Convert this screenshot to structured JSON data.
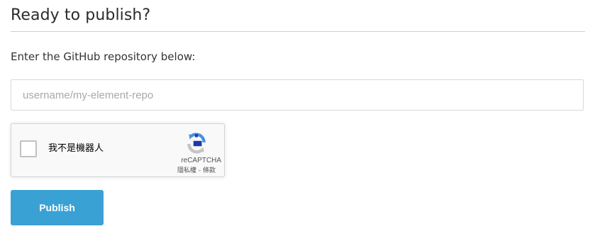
{
  "page": {
    "heading": "Ready to publish?",
    "instruction": "Enter the GitHub repository below:"
  },
  "repo_input": {
    "value": "",
    "placeholder": "username/my-element-repo"
  },
  "recaptcha": {
    "checkbox_label": "我不是機器人",
    "brand": "reCAPTCHA",
    "privacy_link": "隱私權",
    "separator": " - ",
    "terms_link": "條款",
    "logo_icon": "recaptcha-logo-icon",
    "checked": false
  },
  "publish_button": {
    "label": "Publish",
    "color": "#3aa1d5"
  }
}
